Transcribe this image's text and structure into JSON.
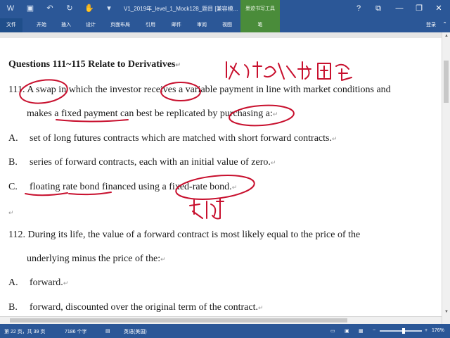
{
  "window": {
    "title": "V1_2019年_level_1_Mock128_题目 [兼容模...",
    "context_tab_title": "墨迹书写工具"
  },
  "ribbon": {
    "tabs": [
      "文件",
      "开始",
      "插入",
      "设计",
      "页面布局",
      "引用",
      "邮件",
      "审阅",
      "视图"
    ],
    "context_tab": "笔",
    "signin": "登录"
  },
  "document": {
    "heading": "Questions 111~115 Relate to Derivatives",
    "q111_line1": "111. A swap in which the investor receives a variable payment in line with market conditions and",
    "q111_line2": "makes a fixed payment can best be replicated by purchasing a:",
    "q111_a_letter": "A.",
    "q111_a": "set of long futures contracts which are matched with short forward contracts.",
    "q111_b_letter": "B.",
    "q111_b": "series of forward contracts, each with an initial value of zero.",
    "q111_c_letter": "C.",
    "q111_c": "floating rate bond financed using a fixed-rate bond.",
    "q112_line1": "112. During its life, the value of a forward contract is most likely equal to the price of the",
    "q112_line2": "underlying minus the price of the:",
    "q112_a_letter": "A.",
    "q112_a": "forward.",
    "q112_b_letter": "B.",
    "q112_b": "forward, discounted over the original term of the contract."
  },
  "status": {
    "page": "第 22 页，共 39 页",
    "words": "7186 个字",
    "language": "英语(美国)",
    "zoom": "176%"
  }
}
